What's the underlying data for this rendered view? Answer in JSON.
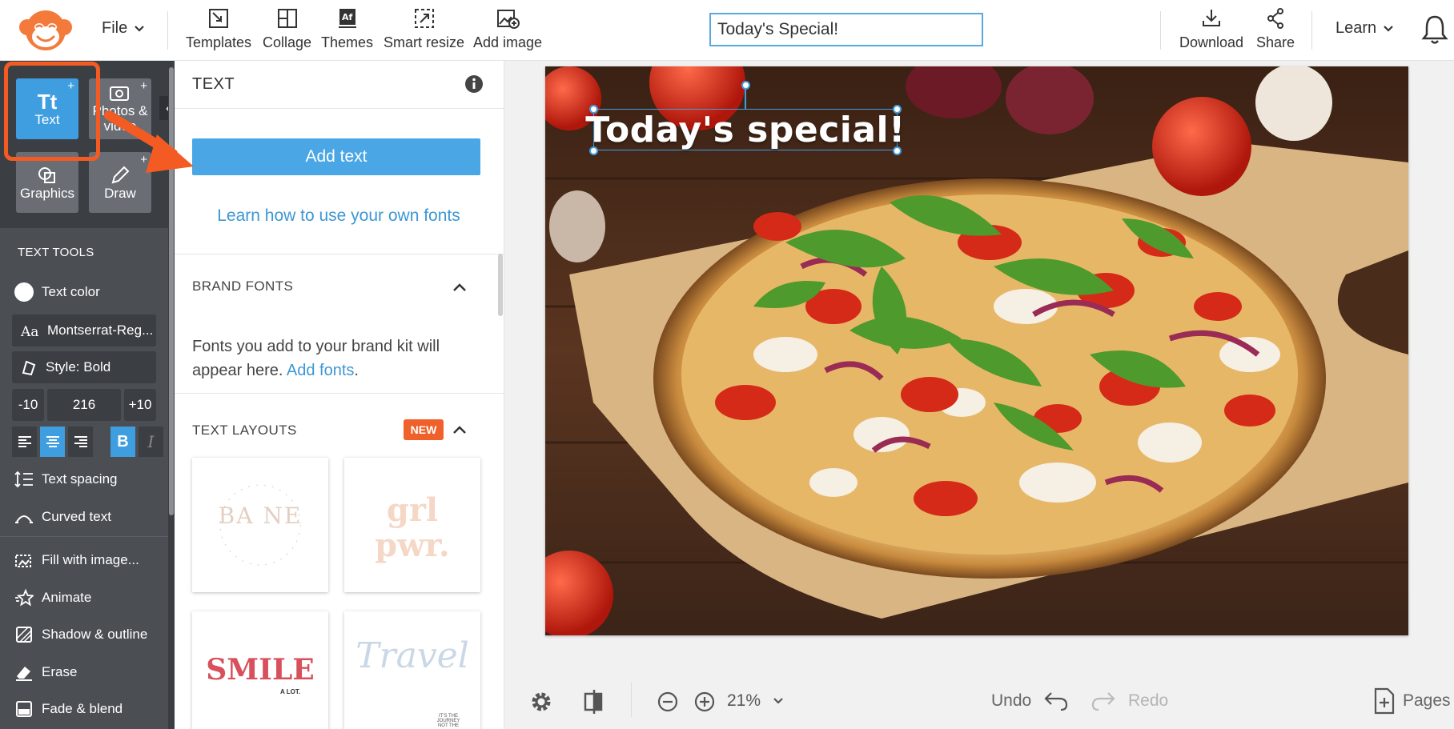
{
  "topbar": {
    "file_label": "File",
    "tools": [
      {
        "label": "Templates",
        "icon": "templates-icon"
      },
      {
        "label": "Collage",
        "icon": "collage-icon"
      },
      {
        "label": "Themes",
        "icon": "themes-icon"
      },
      {
        "label": "Smart resize",
        "icon": "smart-resize-icon"
      },
      {
        "label": "Add image",
        "icon": "add-image-icon"
      }
    ],
    "title_value": "Today's Special!",
    "download_label": "Download",
    "share_label": "Share",
    "learn_label": "Learn"
  },
  "sidebar": {
    "categories": [
      {
        "label": "Text",
        "glyph": "Tt",
        "plus": "+",
        "active": true
      },
      {
        "label": "Photos & video",
        "plus": "+"
      },
      {
        "label": "Graphics"
      },
      {
        "label": "Draw",
        "plus": "+"
      }
    ],
    "text_tools_header": "TEXT TOOLS",
    "text_color_label": "Text color",
    "font_label": "Montserrat-Reg...",
    "style_label": "Style: Bold",
    "size": {
      "dec_label": "-10",
      "value": "216",
      "inc_label": "+10"
    },
    "format_bold": "B",
    "format_italic": "I",
    "tools": [
      {
        "label": "Text spacing",
        "icon": "text-spacing-icon"
      },
      {
        "label": "Curved text",
        "icon": "curved-text-icon"
      },
      {
        "label": "Fill with image...",
        "icon": "fill-image-icon"
      },
      {
        "label": "Animate",
        "icon": "animate-icon"
      },
      {
        "label": "Shadow & outline",
        "icon": "shadow-outline-icon"
      },
      {
        "label": "Erase",
        "icon": "eraser-icon"
      },
      {
        "label": "Fade & blend",
        "icon": "fade-blend-icon"
      }
    ]
  },
  "panel": {
    "title": "TEXT",
    "add_text_label": "Add text",
    "learn_fonts_link": "Learn how to use your own fonts",
    "brand_fonts_header": "BRAND FONTS",
    "brand_desc": "Fonts you add to your brand kit will appear here.",
    "brand_link": "Add fonts",
    "brand_link_suffix": ".",
    "text_layouts_header": "TEXT LAYOUTS",
    "new_badge": "NEW",
    "layouts": [
      {
        "name": "BA NE",
        "ring": "LIFESTYLE BLOGGER"
      },
      {
        "name": "grl pwr."
      },
      {
        "name": "SMILE",
        "sub": "A LOT."
      },
      {
        "name": "Travel",
        "sub": "IT'S THE JOURNEY NOT THE"
      }
    ]
  },
  "canvas": {
    "text": "Today's special!"
  },
  "bottombar": {
    "zoom": "21%",
    "undo_label": "Undo",
    "redo_label": "Redo",
    "pages_label": "Pages"
  },
  "colors": {
    "accent": "#3f9ee0",
    "annotation": "#f45b23",
    "sidebar_dark": "#4b4f54",
    "new_badge": "#f0602a"
  }
}
